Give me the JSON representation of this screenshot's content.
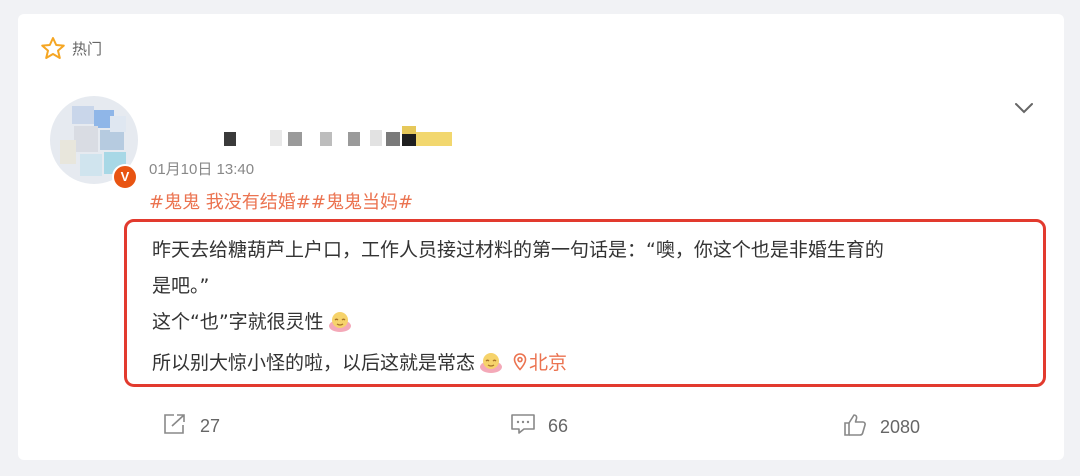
{
  "section": {
    "label": "热门",
    "icon": "star-outline-icon"
  },
  "post": {
    "time": "01月10日 13:40",
    "verified_badge": "V",
    "topics": [
      "#鬼鬼 我没有结婚#",
      "#鬼鬼当妈#"
    ],
    "content_lines": [
      "昨天去给糖葫芦上户口，工作人员接过材料的第一句话是：“噢，你这个也是非婚生育的",
      "是吧。”",
      "这个“也”字就很灵性",
      "所以别大惊小怪的啦，以后这就是常态"
    ],
    "location": "北京"
  },
  "actions": {
    "share_count": "27",
    "comment_count": "66",
    "like_count": "2080"
  },
  "colors": {
    "topic": "#eb7350",
    "highlight_border": "#e23a2e",
    "badge": "#e85412"
  }
}
